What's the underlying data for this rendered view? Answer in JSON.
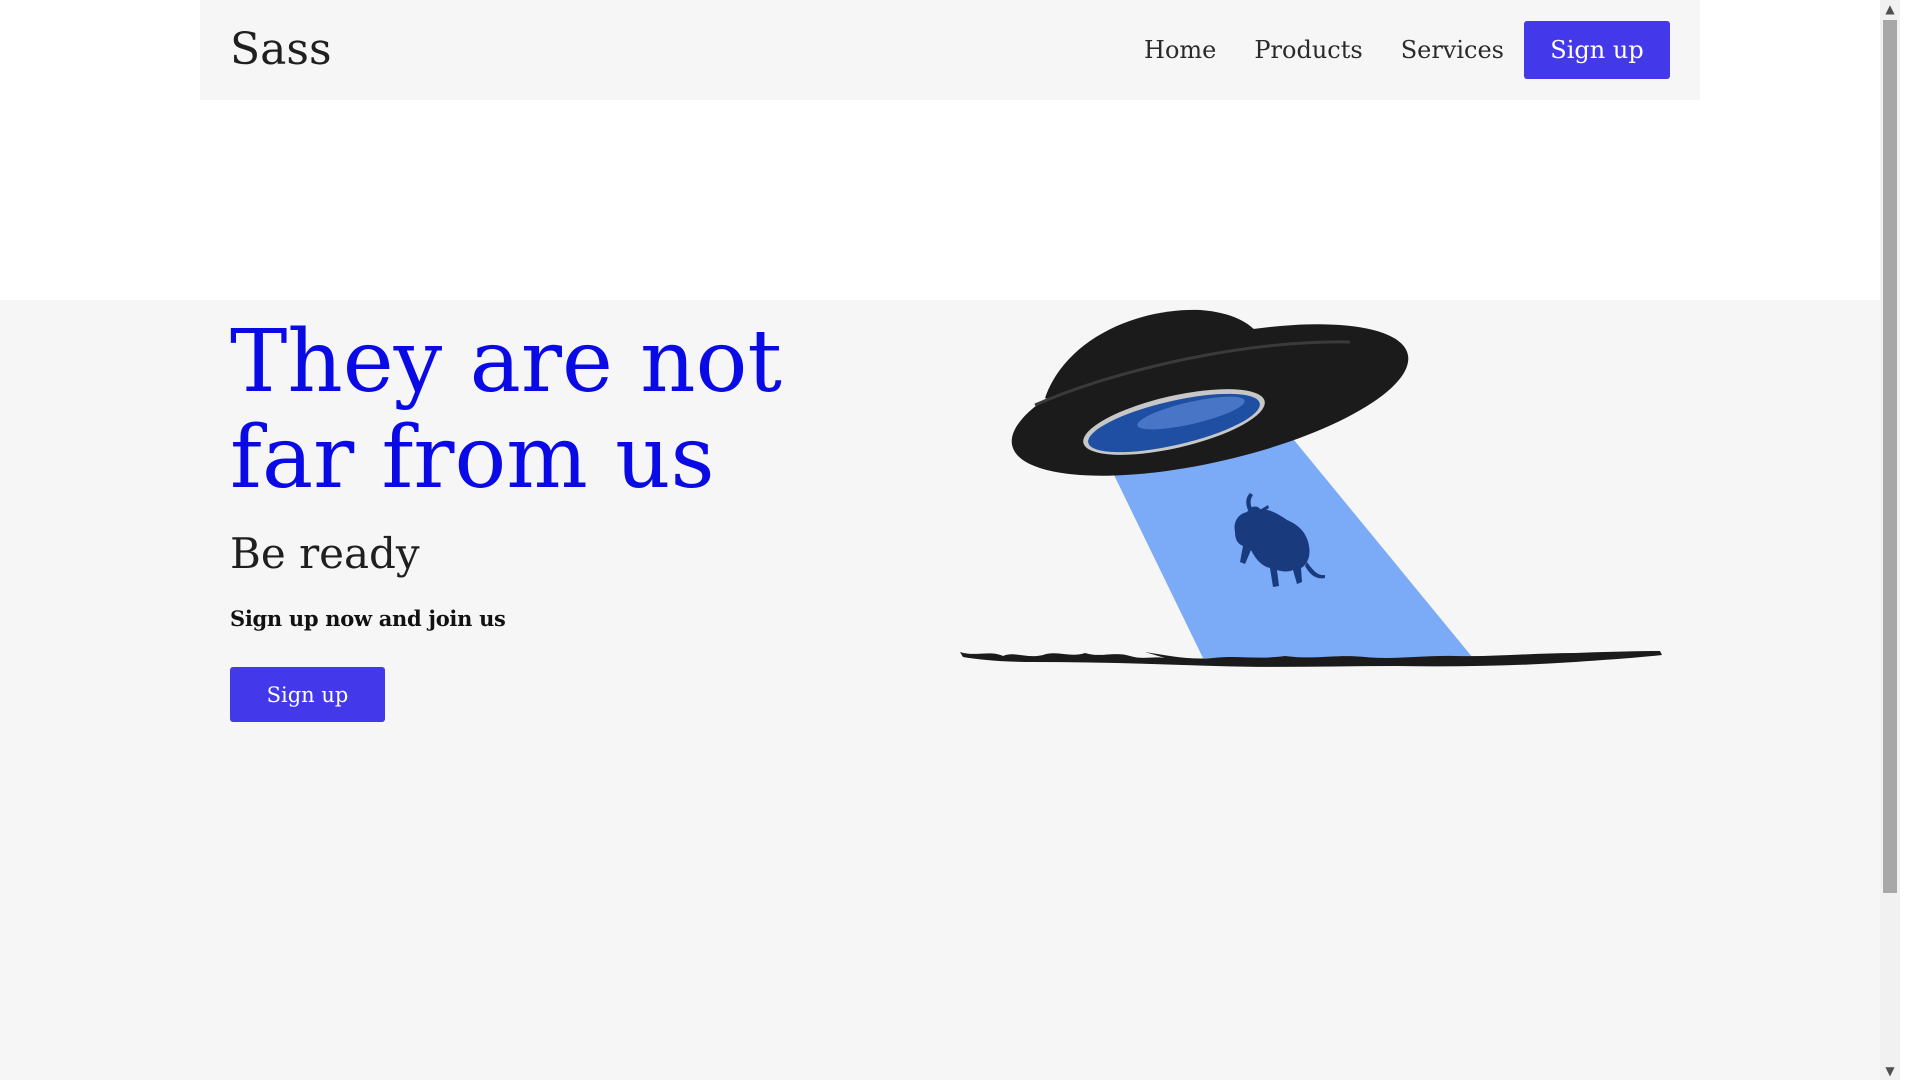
{
  "navbar": {
    "brand": "Sass",
    "links": [
      "Home",
      "Products",
      "Services"
    ],
    "signup_label": "Sign up"
  },
  "hero": {
    "title": "They are not far from us",
    "subtitle": "Be ready",
    "text": "Sign up now and join us",
    "signup_label": "Sign up"
  },
  "illustration": {
    "icons": [
      "ufo-icon",
      "light-beam",
      "cow-icon",
      "ground"
    ]
  },
  "colors": {
    "accent": "#4338ea",
    "title": "#0a0ae6",
    "beam": "#7baaf7",
    "cow": "#1a3a7e",
    "ufo": "#1b1b1b"
  }
}
